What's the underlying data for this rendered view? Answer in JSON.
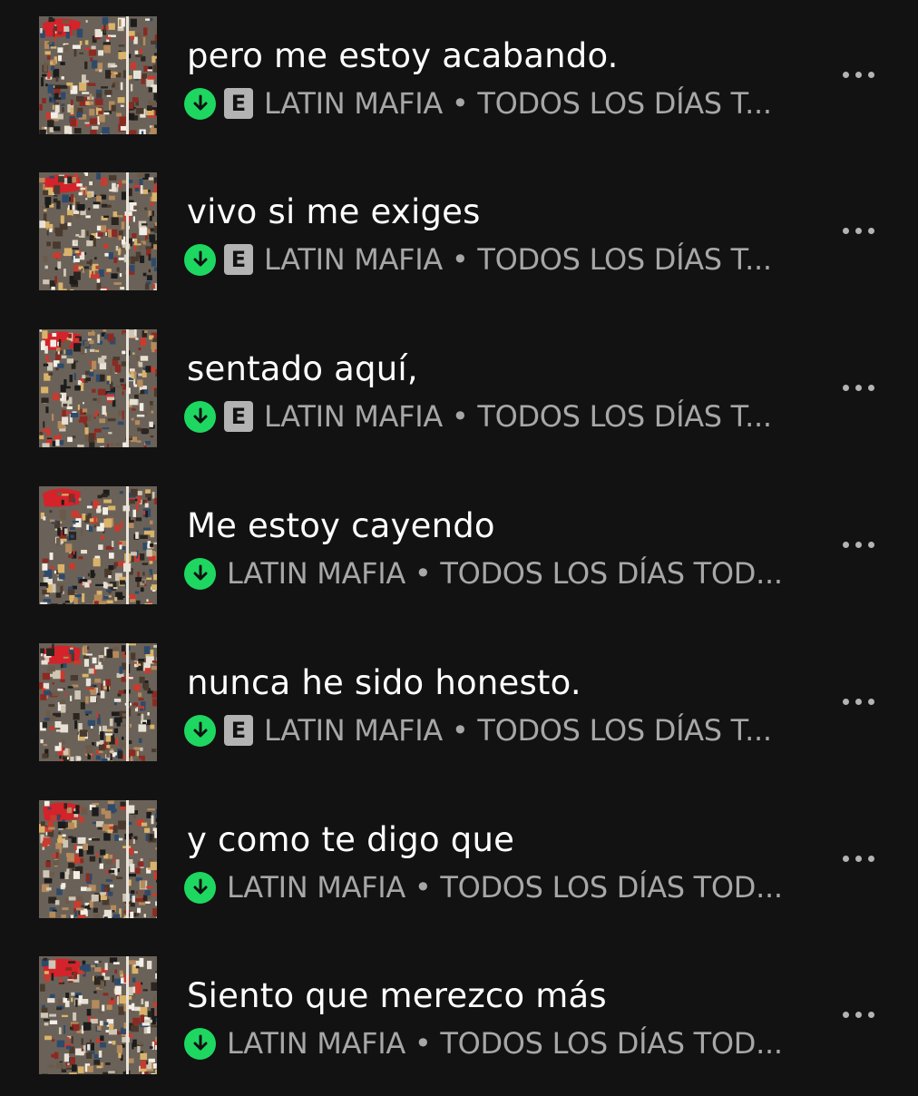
{
  "accent_color": "#1ed760",
  "icons": {
    "download": "download-arrow-icon",
    "explicit": "explicit-badge",
    "more": "more-options-icon"
  },
  "tracks": [
    {
      "title": "pero me estoy acabando.",
      "explicit": true,
      "explicit_label": "E",
      "subtitle": "LATIN MAFIA • TODOS LOS DÍAS T..."
    },
    {
      "title": "vivo si me exiges",
      "explicit": true,
      "explicit_label": "E",
      "subtitle": "LATIN MAFIA • TODOS LOS DÍAS T..."
    },
    {
      "title": "sentado aquí,",
      "explicit": true,
      "explicit_label": "E",
      "subtitle": "LATIN MAFIA • TODOS LOS DÍAS T..."
    },
    {
      "title": "Me estoy cayendo",
      "explicit": false,
      "explicit_label": "",
      "subtitle": "LATIN MAFIA • TODOS LOS DÍAS TOD..."
    },
    {
      "title": "nunca he sido honesto.",
      "explicit": true,
      "explicit_label": "E",
      "subtitle": "LATIN MAFIA • TODOS LOS DÍAS T..."
    },
    {
      "title": "y como te digo que",
      "explicit": false,
      "explicit_label": "",
      "subtitle": "LATIN MAFIA • TODOS LOS DÍAS TOD..."
    },
    {
      "title": "Siento que merezco más",
      "explicit": false,
      "explicit_label": "",
      "subtitle": "LATIN MAFIA • TODOS LOS DÍAS TOD..."
    }
  ]
}
